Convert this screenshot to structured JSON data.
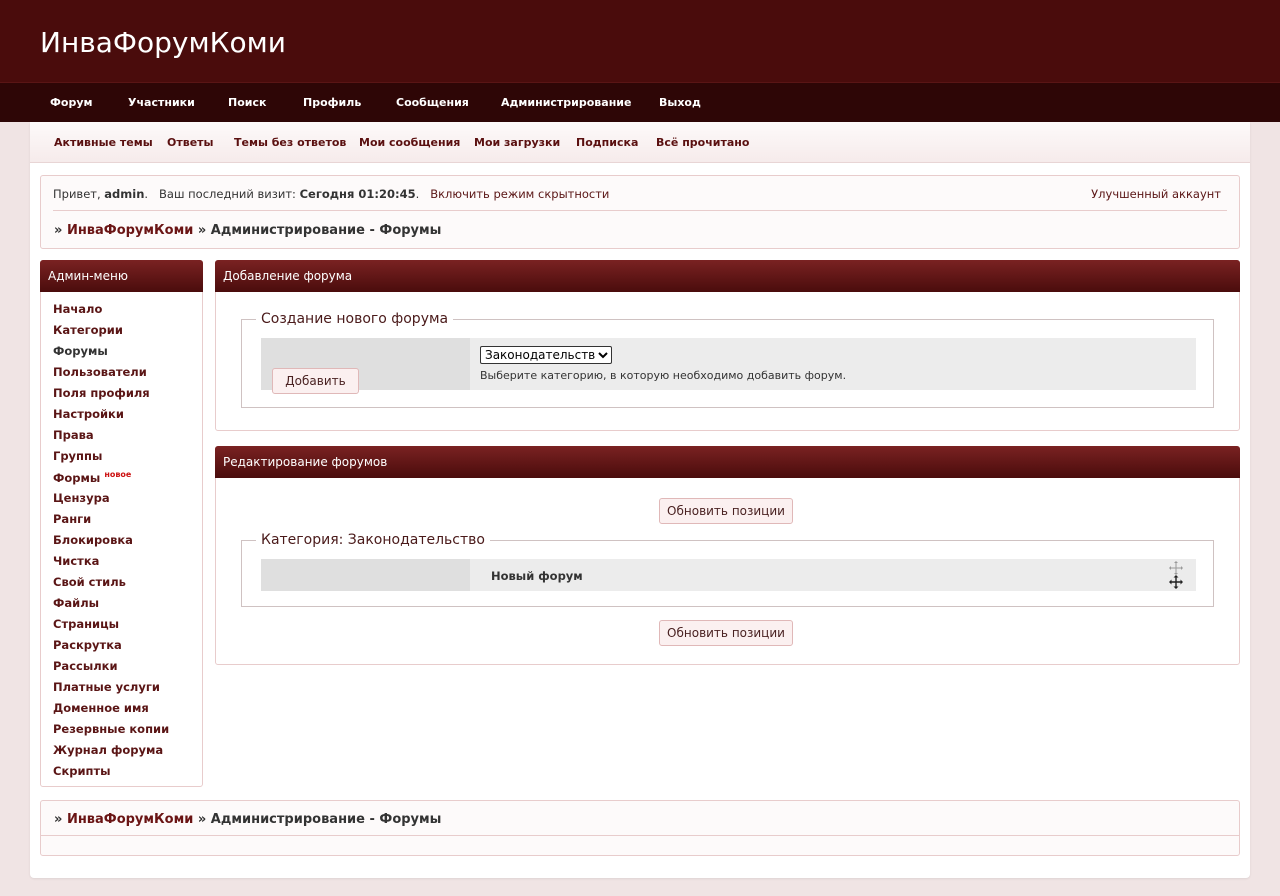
{
  "header": {
    "logo": "ИнваФорумКоми"
  },
  "topnav": [
    "Форум",
    "Участники",
    "Поиск",
    "Профиль",
    "Сообщения",
    "Администрирование",
    "Выход"
  ],
  "subnav": [
    "Активные темы",
    "Ответы",
    "Темы без ответов",
    "Мои сообщения",
    "Мои загрузки",
    "Подписка",
    "Всё прочитано"
  ],
  "welcome": {
    "greeting": "Привет,",
    "username": "admin",
    "last_visit_label": "Ваш последний визит:",
    "last_visit_value": "Сегодня 01:20:45",
    "stealth_link": "Включить режим скрытности",
    "upgrade_link": "Улучшенный аккаунт"
  },
  "breadcrumb": {
    "sep": "»",
    "root": "ИнваФорумКоми",
    "current": "Администрирование - Форумы"
  },
  "admin_menu": {
    "title": "Админ-меню",
    "items": [
      "Начало",
      "Категории",
      "Форумы",
      "Пользователи",
      "Поля профиля",
      "Настройки",
      "Права",
      "Группы",
      "Формы",
      "Цензура",
      "Ранги",
      "Блокировка",
      "Чистка",
      "Свой стиль",
      "Файлы",
      "Страницы",
      "Раскрутка",
      "Рассылки",
      "Платные услуги",
      "Доменное имя",
      "Резервные копии",
      "Журнал форума",
      "Скрипты"
    ],
    "new_badge": "новое"
  },
  "add_forum": {
    "title": "Добавление форума",
    "legend": "Создание нового форума",
    "select_value": "Законодательство",
    "hint": "Выберите категорию, в которую необходимо добавить форум.",
    "add_button": "Добавить"
  },
  "edit_forums": {
    "title": "Редактирование форумов",
    "update_button": "Обновить позиции",
    "category_legend": "Категория: Законодательство",
    "forum_name": "Новый форум",
    "move_icon": "move-arrows-icon"
  }
}
